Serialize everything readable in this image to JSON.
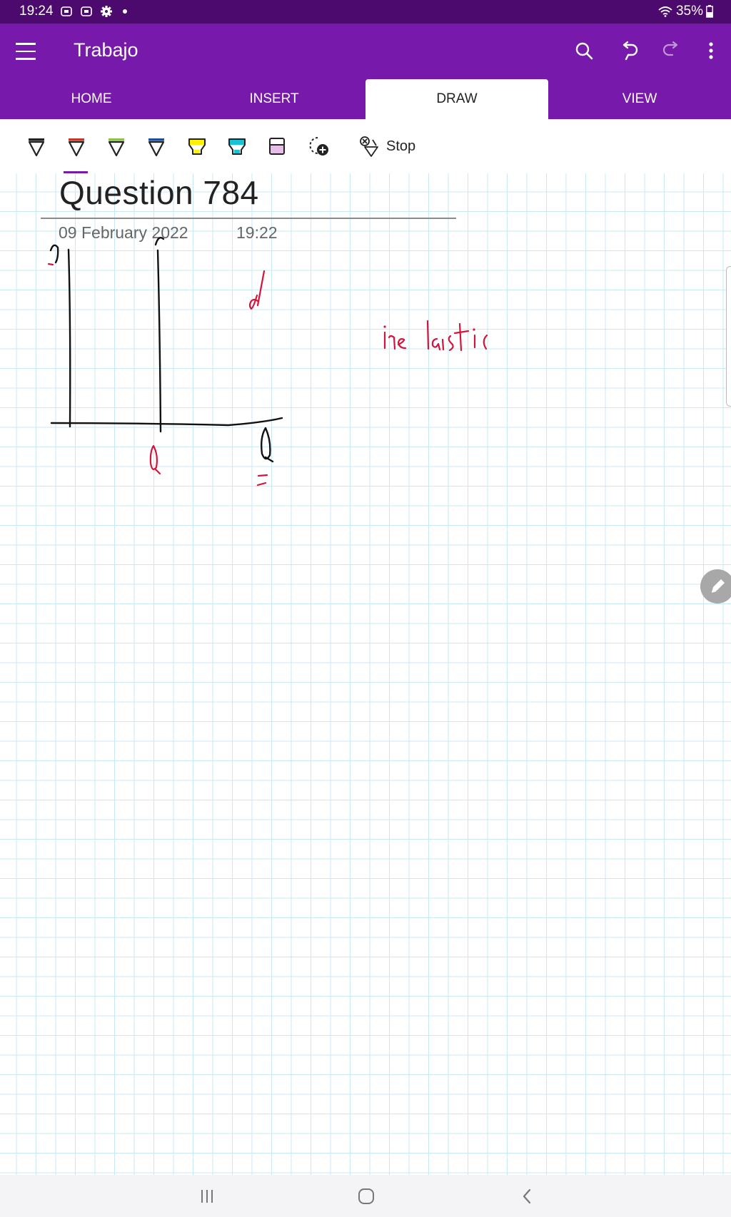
{
  "status_bar": {
    "time": "19:24",
    "battery": "35%"
  },
  "app": {
    "title": "Trabajo"
  },
  "tabs": [
    {
      "label": "HOME"
    },
    {
      "label": "INSERT"
    },
    {
      "label": "DRAW",
      "active": true
    },
    {
      "label": "VIEW"
    }
  ],
  "draw_toolbar": {
    "tools": [
      {
        "icon": "pen-icon",
        "color": "#222222"
      },
      {
        "icon": "pen-icon",
        "color": "#c0392b",
        "selected": true
      },
      {
        "icon": "pen-icon",
        "color": "#8bc34a"
      },
      {
        "icon": "pen-icon",
        "color": "#1f4e9c"
      },
      {
        "icon": "highlighter-icon",
        "color": "#fff200"
      },
      {
        "icon": "highlighter-icon",
        "color": "#19c3d6"
      },
      {
        "icon": "highlighter-icon",
        "color": "#e6bfe6"
      },
      {
        "icon": "add-pen-icon",
        "color": "#222222"
      }
    ],
    "stop_label": "Stop"
  },
  "page": {
    "title": "Question 784",
    "date": "09 February 2022",
    "time": "19:22"
  },
  "colors": {
    "accent": "#7719aa",
    "status_bar": "#4d0a6e",
    "ink_black": "#111111",
    "ink_red": "#d4143c",
    "grid": "#c7e9f5"
  }
}
